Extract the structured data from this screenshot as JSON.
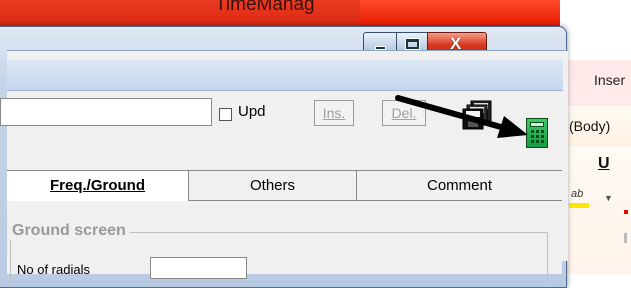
{
  "background_app": {
    "title": "TimeManag",
    "ribbon_tab": "Inser",
    "font_name": "(Body)",
    "underline_label": "U",
    "highlight_label": "ab",
    "dropdown_glyph": "▼"
  },
  "dialog": {
    "caption_buttons": {
      "minimize": "_",
      "maximize": "□",
      "close": "X"
    },
    "toolbar": {
      "upd_label": "Upd",
      "ins_label": "Ins.",
      "del_label": "Del."
    },
    "tabs": [
      {
        "label": "Freq./Ground",
        "active": true
      },
      {
        "label": "Others",
        "active": false
      },
      {
        "label": "Comment",
        "active": false
      }
    ],
    "group": {
      "title": "Ground screen",
      "field_label": "No of radials"
    }
  },
  "icons": {
    "save": "floppy-disks-icon",
    "calc": "calculator-icon",
    "arrow": "arrow-pointer"
  },
  "colors": {
    "titlebar": "#e61800",
    "dialog_frame": "#c7d6ea",
    "calc_green": "#159b41"
  }
}
